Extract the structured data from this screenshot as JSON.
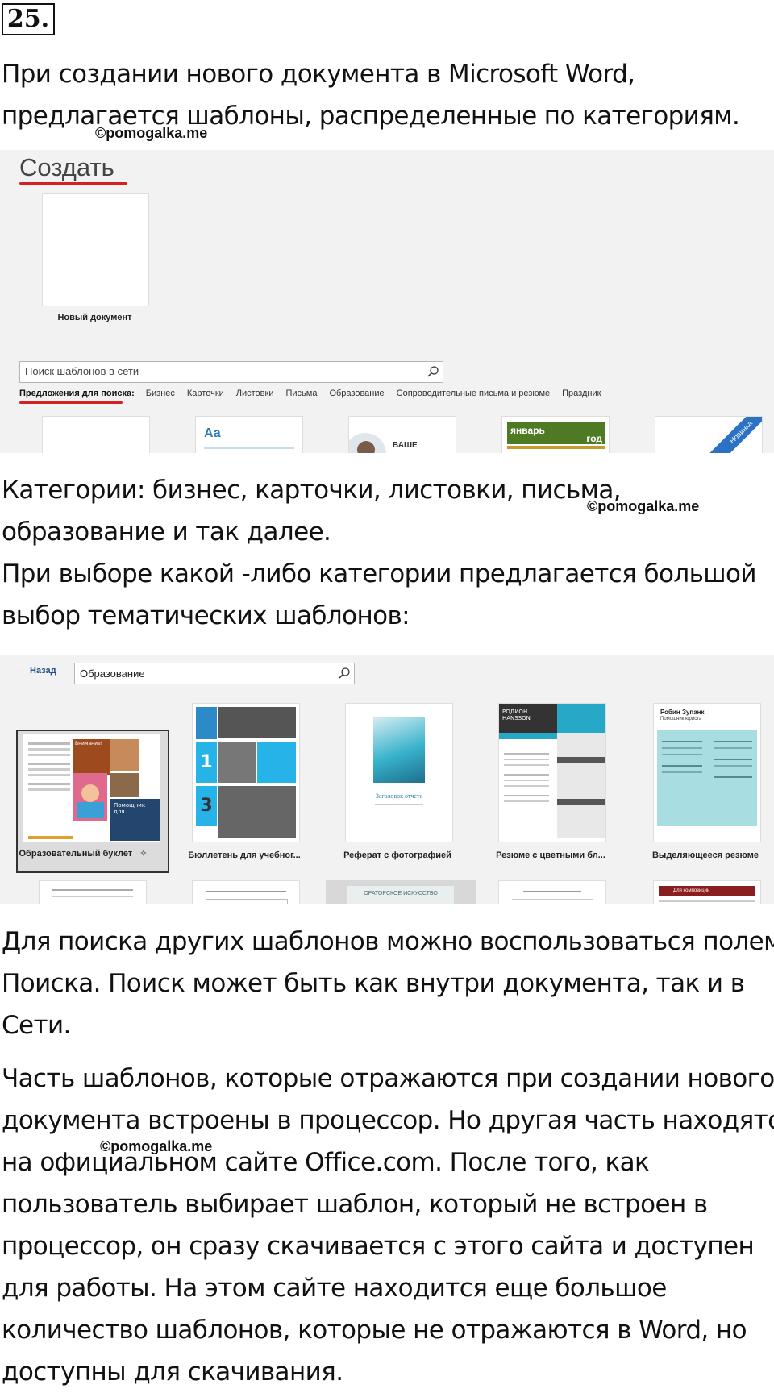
{
  "task_number": "25.",
  "intro_lines": [
    "При создании нового документа в Microsoft Word,",
    "предлагается шаблоны, распределенные по категориям."
  ],
  "watermark": "©pomogalka.me",
  "screen1": {
    "title": "Создать",
    "new_document_label": "Новый документ",
    "search_placeholder": "Поиск шаблонов в сети",
    "suggestions_label": "Предложения для поиска:",
    "suggestions": [
      "Бизнес",
      "Карточки",
      "Листовки",
      "Письма",
      "Образование",
      "Сопроводительные письма и резюме",
      "Праздник"
    ],
    "thumb_texts": {
      "aa": "Аа",
      "vashe": "ВАШЕ",
      "month": "январь",
      "year": "год",
      "new_badge": "Новинка"
    }
  },
  "para2_lines": [
    "Категории: бизнес, карточки, листовки, письма,",
    "образование и так далее.",
    "При выборе какой -либо категории предлагается большой",
    "выбор тематических шаблонов:"
  ],
  "screen2": {
    "back_label": "Назад",
    "search_value": "Образование",
    "templates": [
      "Образовательный буклет",
      "Бюллетень для учебног...",
      "Реферат с фотографией",
      "Резюме с цветными бл...",
      "Выделяющееся резюме"
    ],
    "thumb_texts": {
      "booklet_1": "Внимание!",
      "booklet_2": "Помощник для",
      "report_title": "Заголовок отчета",
      "name_1": "РОДИОН",
      "name_2": "HANSSON",
      "name_3": "Робин Зупанк",
      "sub_3": "Помощник юриста",
      "bottom_1": "ОРАТОРСКОЕ ИСКУССТВО",
      "bottom_2": "Для композиции"
    }
  },
  "para3_lines": [
    "Для поиска других шаблонов можно воспользоваться полем",
    "Поиска. Поиск может быть как внутри документа, так и в",
    "Сети."
  ],
  "para4_lines": [
    "Часть шаблонов, которые отражаются при создании нового",
    "документа встроены в процессор. Но другая часть находятся",
    "на официальном сайте Office.com. После того, как",
    "пользователь выбирает шаблон, который не встроен в",
    "процессор, он сразу скачивается с этого сайта и доступен",
    "для работы. На этом сайте находится еще большое",
    "количество шаблонов, которые не отражаются в Word, но",
    "доступны для скачивания."
  ]
}
